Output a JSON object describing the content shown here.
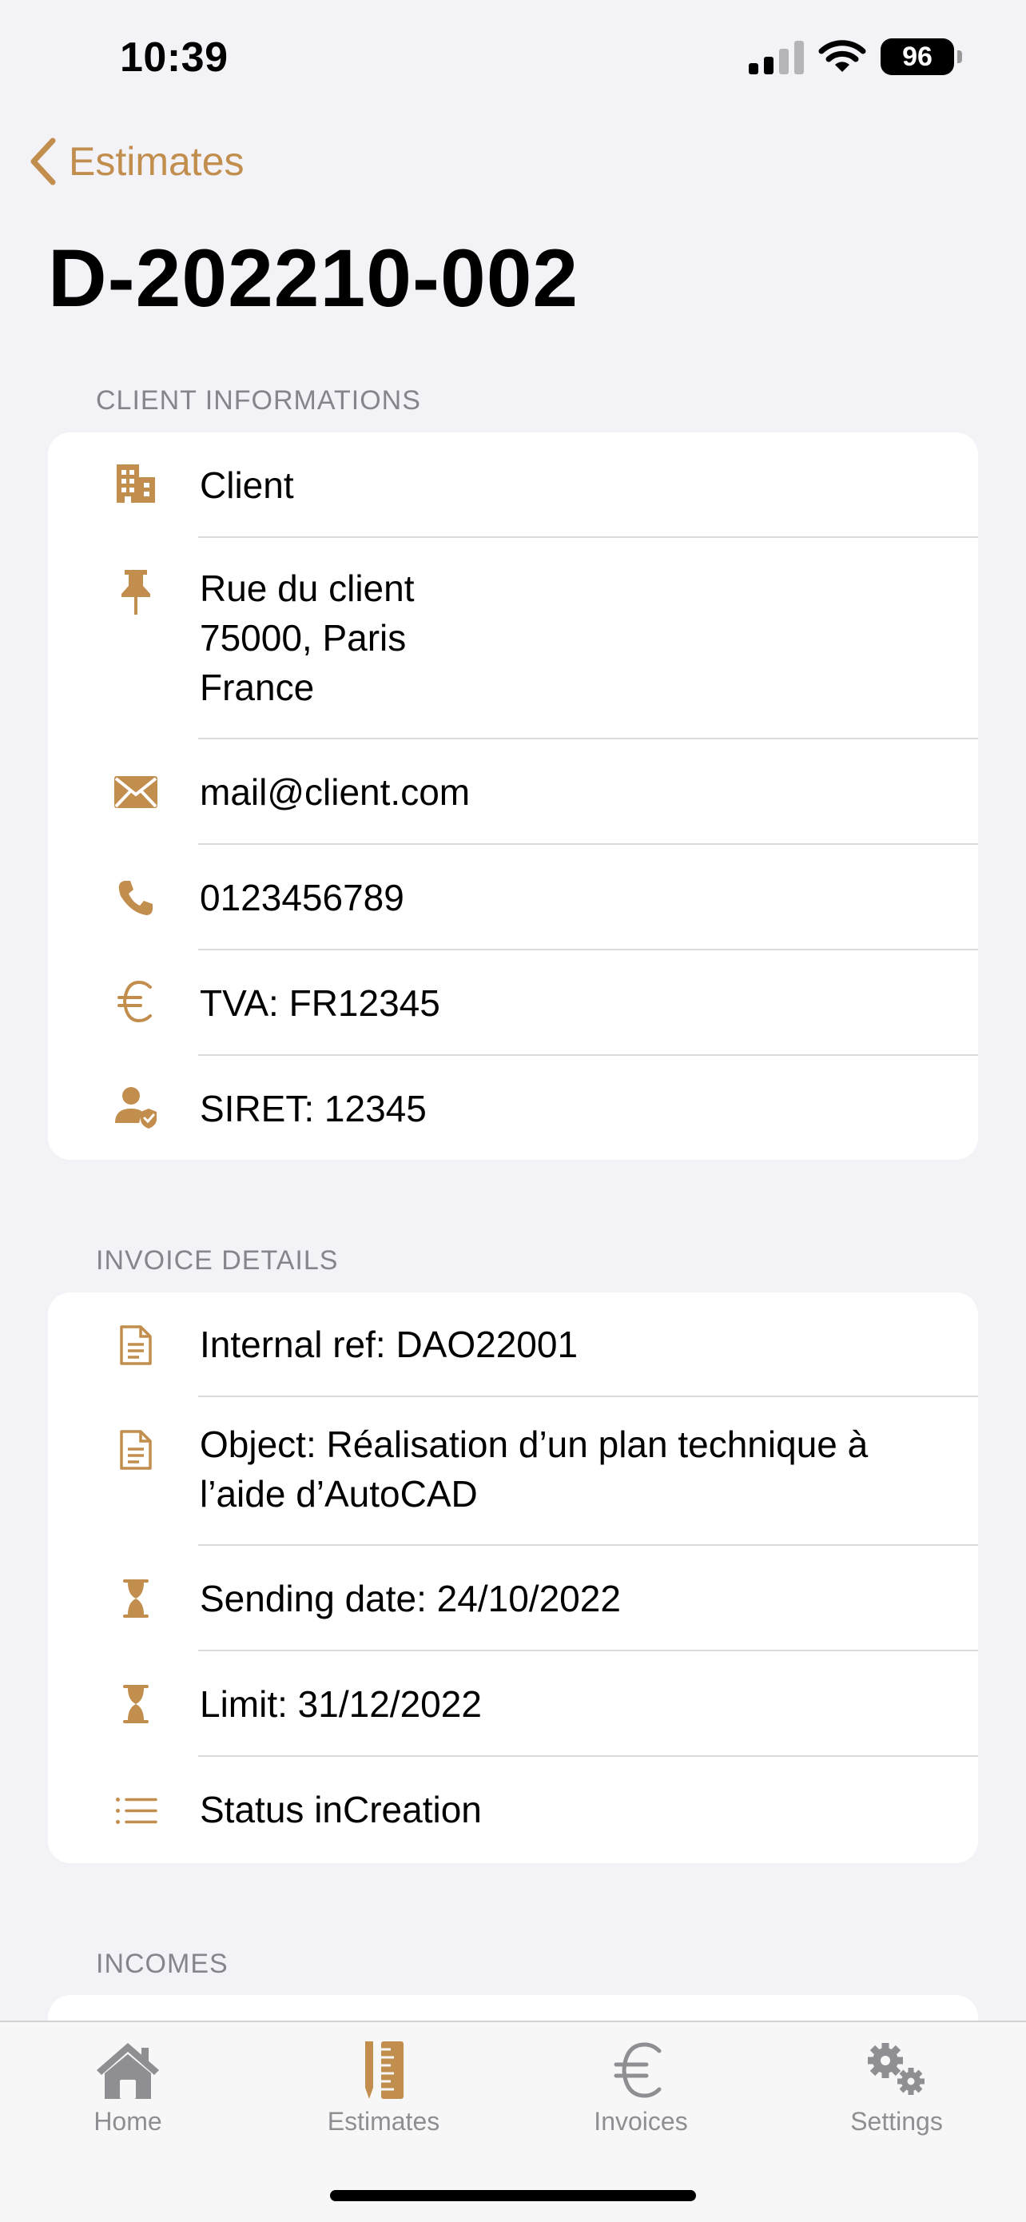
{
  "status_bar": {
    "time": "10:39",
    "battery": "96"
  },
  "nav": {
    "back_label": "Estimates"
  },
  "title": "D-202210-002",
  "client_section": {
    "header": "CLIENT INFORMATIONS",
    "name": "Client",
    "address_line1": "Rue du client",
    "address_line2": "75000, Paris",
    "address_line3": "France",
    "email": "mail@client.com",
    "phone": "0123456789",
    "tva": "TVA: FR12345",
    "siret": "SIRET:  12345"
  },
  "invoice_section": {
    "header": "INVOICE DETAILS",
    "internal_ref": "Internal ref: DAO22001",
    "object_line1": "Object:  Réalisation d’un plan technique à",
    "object_line2": "l’aide d’AutoCAD",
    "sending_date": "Sending date: 24/10/2022",
    "limit": "Limit: 31/12/2022",
    "status": "Status inCreation"
  },
  "incomes_section": {
    "header": "INCOMES"
  },
  "tabs": [
    {
      "label": "Home",
      "icon": "house-icon",
      "active": false
    },
    {
      "label": "Estimates",
      "icon": "pencil-ruler-icon",
      "active": true
    },
    {
      "label": "Invoices",
      "icon": "euro-icon",
      "active": false
    },
    {
      "label": "Settings",
      "icon": "gears-icon",
      "active": false
    }
  ],
  "colors": {
    "accent": "#c28e4e",
    "background": "#f2f2f7",
    "inactive": "#8e8e93"
  }
}
